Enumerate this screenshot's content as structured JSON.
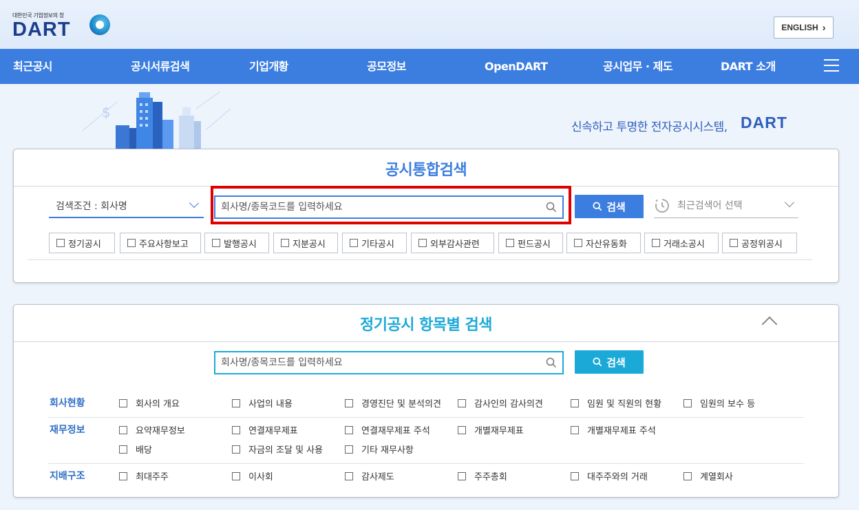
{
  "header": {
    "logo_subtitle": "대한민국 기업정보의 창",
    "logo_text": "DART",
    "english_label": "ENGLISH",
    "english_chevron": "›"
  },
  "nav": {
    "items": [
      {
        "label": "최근공시"
      },
      {
        "label": "공시서류검색"
      },
      {
        "label": "기업개황"
      },
      {
        "label": "공모정보"
      },
      {
        "label": "OpenDART"
      },
      {
        "label": "공시업무 · 제도"
      },
      {
        "label": "DART 소개"
      }
    ],
    "menu_icon": "hamburger-icon"
  },
  "banner": {
    "slogan": "신속하고 투명한 전자공시시스템,",
    "slogan_brand": "DART"
  },
  "unified_search": {
    "title": "공시통합검색",
    "condition_label": "검색조건 : 회사명",
    "search_placeholder": "회사명/종목코드를 입력하세요",
    "search_button": "검색",
    "recent_label": "최근검색어 선택",
    "checkboxes": [
      {
        "label": "정기공시"
      },
      {
        "label": "주요사항보고"
      },
      {
        "label": "발행공시"
      },
      {
        "label": "지분공시"
      },
      {
        "label": "기타공시"
      },
      {
        "label": "외부감사관련"
      },
      {
        "label": "펀드공시"
      },
      {
        "label": "자산유동화"
      },
      {
        "label": "거래소공시"
      },
      {
        "label": "공정위공시"
      }
    ],
    "colors": {
      "accent": "#3c7ee0",
      "highlight": "#e00000"
    }
  },
  "item_search": {
    "title": "정기공시 항목별 검색",
    "search_placeholder": "회사명/종목코드를 입력하세요",
    "search_button": "검색",
    "colors": {
      "accent": "#1ba9d8"
    },
    "categories": [
      {
        "label": "회사현황",
        "items": [
          "회사의 개요",
          "사업의 내용",
          "경영진단 및 분석의견",
          "감사인의 감사의견",
          "임원 및 직원의 현황",
          "임원의 보수 등"
        ]
      },
      {
        "label": "재무정보",
        "items": [
          "요약재무정보",
          "연결재무제표",
          "연결재무제표 주석",
          "개별재무제표",
          "개별재무제표 주석",
          "배당",
          "자금의 조달 및 사용",
          "기타 재무사항"
        ]
      },
      {
        "label": "지배구조",
        "items": [
          "최대주주",
          "이사회",
          "감사제도",
          "주주총회",
          "대주주와의 거래",
          "계열회사"
        ]
      }
    ]
  }
}
